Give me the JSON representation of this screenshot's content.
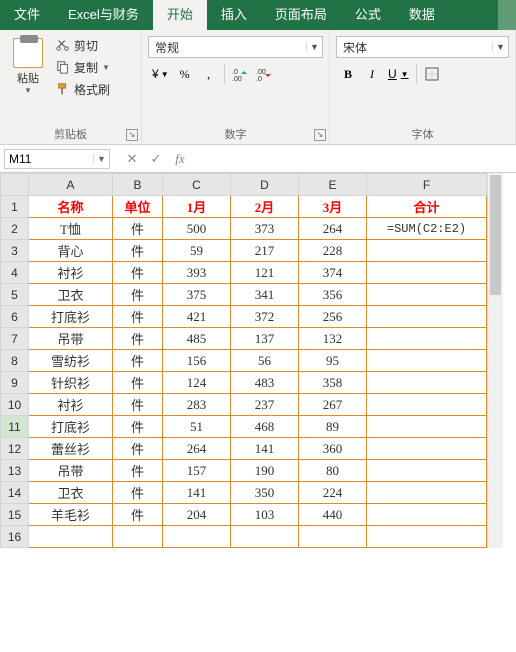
{
  "tabs": [
    "文件",
    "Excel与财务",
    "开始",
    "插入",
    "页面布局",
    "公式",
    "数据"
  ],
  "activeTab": 2,
  "clipboard": {
    "paste": "粘贴",
    "cut": "剪切",
    "copy": "复制",
    "formatPainter": "格式刷",
    "group": "剪贴板"
  },
  "numberGroup": {
    "formatCombo": "常规",
    "group": "数字",
    "currency": "¥",
    "percent": "%",
    "comma": ",",
    "incDec": ".0",
    "decDec": ".00"
  },
  "fontGroup": {
    "fontCombo": "宋体",
    "group": "字体",
    "bold": "B",
    "italic": "I",
    "underline": "U"
  },
  "nameBox": "M11",
  "formula": "",
  "columns": [
    "A",
    "B",
    "C",
    "D",
    "E",
    "F"
  ],
  "headerRow": [
    "名称",
    "单位",
    "1月",
    "2月",
    "3月",
    "合计"
  ],
  "rows": [
    {
      "n": "T恤",
      "u": "件",
      "m1": "500",
      "m2": "373",
      "m3": "264",
      "t": "=SUM(C2:E2)"
    },
    {
      "n": "背心",
      "u": "件",
      "m1": "59",
      "m2": "217",
      "m3": "228",
      "t": ""
    },
    {
      "n": "衬衫",
      "u": "件",
      "m1": "393",
      "m2": "121",
      "m3": "374",
      "t": ""
    },
    {
      "n": "卫衣",
      "u": "件",
      "m1": "375",
      "m2": "341",
      "m3": "356",
      "t": ""
    },
    {
      "n": "打底衫",
      "u": "件",
      "m1": "421",
      "m2": "372",
      "m3": "256",
      "t": ""
    },
    {
      "n": "吊带",
      "u": "件",
      "m1": "485",
      "m2": "137",
      "m3": "132",
      "t": ""
    },
    {
      "n": "雪纺衫",
      "u": "件",
      "m1": "156",
      "m2": "56",
      "m3": "95",
      "t": ""
    },
    {
      "n": "针织衫",
      "u": "件",
      "m1": "124",
      "m2": "483",
      "m3": "358",
      "t": ""
    },
    {
      "n": "衬衫",
      "u": "件",
      "m1": "283",
      "m2": "237",
      "m3": "267",
      "t": ""
    },
    {
      "n": "打底衫",
      "u": "件",
      "m1": "51",
      "m2": "468",
      "m3": "89",
      "t": ""
    },
    {
      "n": "蕾丝衫",
      "u": "件",
      "m1": "264",
      "m2": "141",
      "m3": "360",
      "t": ""
    },
    {
      "n": "吊带",
      "u": "件",
      "m1": "157",
      "m2": "190",
      "m3": "80",
      "t": ""
    },
    {
      "n": "卫衣",
      "u": "件",
      "m1": "141",
      "m2": "350",
      "m3": "224",
      "t": ""
    },
    {
      "n": "羊毛衫",
      "u": "件",
      "m1": "204",
      "m2": "103",
      "m3": "440",
      "t": ""
    }
  ],
  "emptyRow": 16,
  "selected": {
    "row": 11,
    "col": "M"
  }
}
